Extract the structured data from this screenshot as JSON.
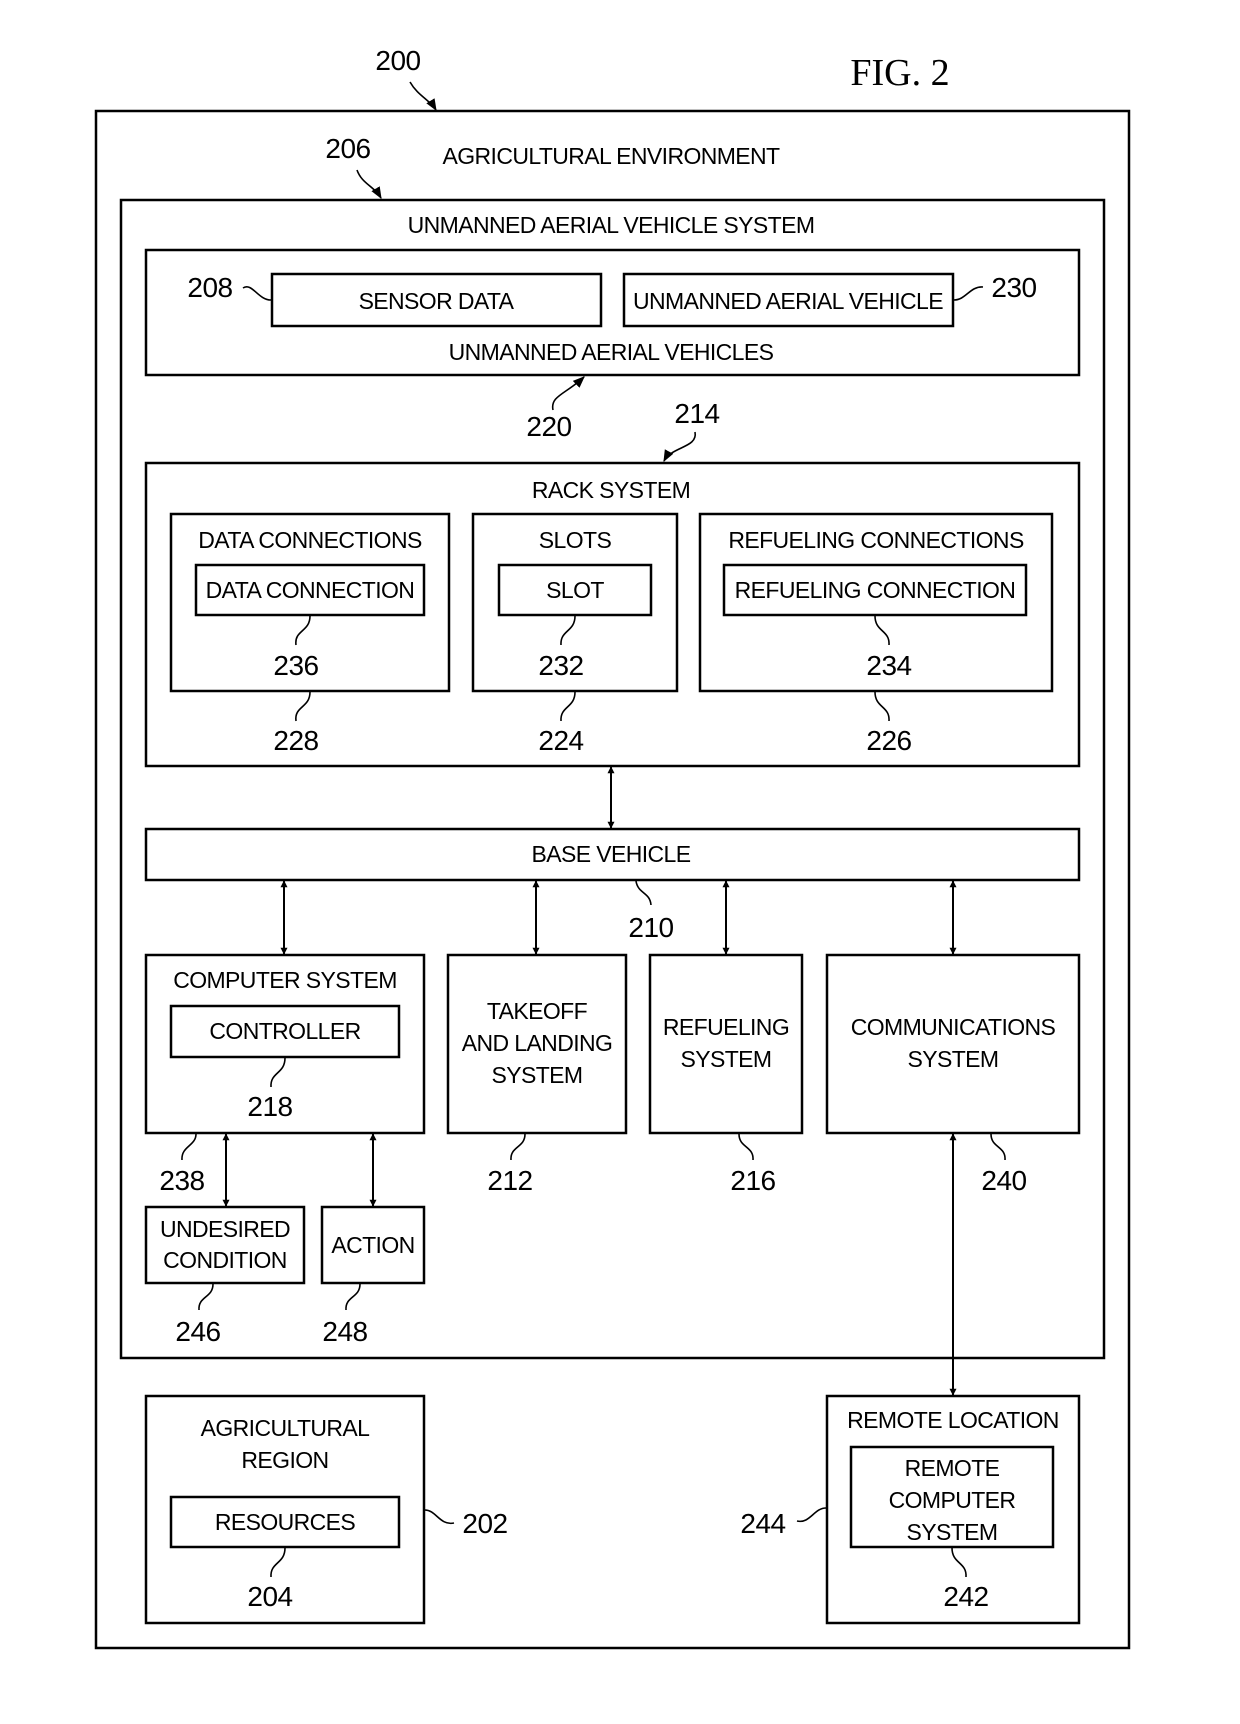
{
  "figure": {
    "title": "FIG. 2",
    "ref": "200"
  },
  "environment": {
    "label": "AGRICULTURAL ENVIRONMENT",
    "ref": "206"
  },
  "uav_system": {
    "label": "UNMANNED AERIAL VEHICLE SYSTEM",
    "uavs": {
      "label": "UNMANNED AERIAL VEHICLES",
      "ref": "220",
      "sensor_data": {
        "label": "SENSOR DATA",
        "ref": "208"
      },
      "uav": {
        "label": "UNMANNED AERIAL VEHICLE",
        "ref": "230"
      }
    },
    "rack_system": {
      "label": "RACK SYSTEM",
      "ref": "214",
      "data_connections": {
        "label": "DATA CONNECTIONS",
        "ref": "228",
        "inner_label": "DATA CONNECTION",
        "inner_ref": "236"
      },
      "slots": {
        "label": "SLOTS",
        "ref": "224",
        "inner_label": "SLOT",
        "inner_ref": "232"
      },
      "refueling_connections": {
        "label": "REFUELING CONNECTIONS",
        "ref": "226",
        "inner_label": "REFUELING CONNECTION",
        "inner_ref": "234"
      }
    },
    "base_vehicle": {
      "label": "BASE VEHICLE",
      "ref": "210"
    },
    "computer_system": {
      "label": "COMPUTER SYSTEM",
      "ref": "238",
      "controller_label": "CONTROLLER",
      "controller_ref": "218"
    },
    "takeoff_landing": {
      "lines": [
        "TAKEOFF",
        "AND LANDING",
        "SYSTEM"
      ],
      "ref": "212"
    },
    "refueling_system": {
      "lines": [
        "REFUELING",
        "SYSTEM"
      ],
      "ref": "216"
    },
    "communications_system": {
      "lines": [
        "COMMUNICATIONS",
        "SYSTEM"
      ],
      "ref": "240"
    },
    "undesired_condition": {
      "lines": [
        "UNDESIRED",
        "CONDITION"
      ],
      "ref": "246"
    },
    "action": {
      "label": "ACTION",
      "ref": "248"
    }
  },
  "agricultural_region": {
    "lines": [
      "AGRICULTURAL",
      "REGION"
    ],
    "ref": "202",
    "resources_label": "RESOURCES",
    "resources_ref": "204"
  },
  "remote_location": {
    "label": "REMOTE LOCATION",
    "ref": "244",
    "computer_lines": [
      "REMOTE",
      "COMPUTER",
      "SYSTEM"
    ],
    "computer_ref": "242"
  }
}
